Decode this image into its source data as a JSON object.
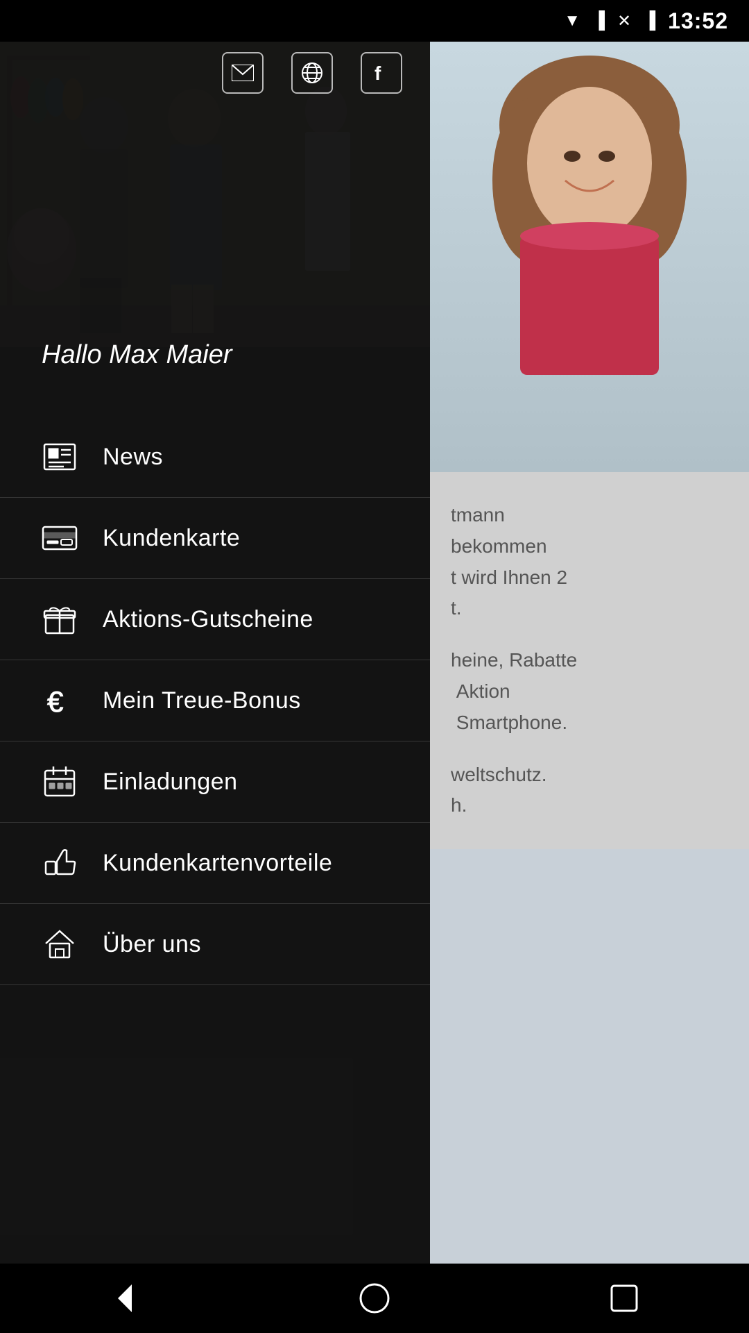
{
  "status_bar": {
    "time": "13:52",
    "icons": [
      "wifi",
      "signal",
      "close",
      "battery"
    ]
  },
  "top_icons": [
    {
      "name": "email-icon",
      "symbol": "✉"
    },
    {
      "name": "globe-icon",
      "symbol": "🌐"
    },
    {
      "name": "facebook-icon",
      "symbol": "f"
    }
  ],
  "drawer": {
    "greeting": "Hallo Max Maier",
    "menu_items": [
      {
        "id": "news",
        "label": "News",
        "icon": "newspaper"
      },
      {
        "id": "kundenkarte",
        "label": "Kundenkarte",
        "icon": "card"
      },
      {
        "id": "aktions-gutscheine",
        "label": "Aktions-Gutscheine",
        "icon": "gift"
      },
      {
        "id": "mein-treue-bonus",
        "label": "Mein Treue-Bonus",
        "icon": "euro"
      },
      {
        "id": "einladungen",
        "label": "Einladungen",
        "icon": "calendar"
      },
      {
        "id": "kundenkartenvorteile",
        "label": "Kundenkartenvorteile",
        "icon": "thumbs-up"
      },
      {
        "id": "uber-uns",
        "label": "Über uns",
        "icon": "home"
      }
    ]
  },
  "main_content": {
    "text_blocks": [
      "tmann\nbekommen\nt wird Ihnen 2\nt.",
      "heine, Rabatte\n Aktion\n Smartphone.",
      "weltschutz.\nh."
    ]
  },
  "nav_bar": {
    "buttons": [
      "back",
      "home",
      "square"
    ]
  }
}
